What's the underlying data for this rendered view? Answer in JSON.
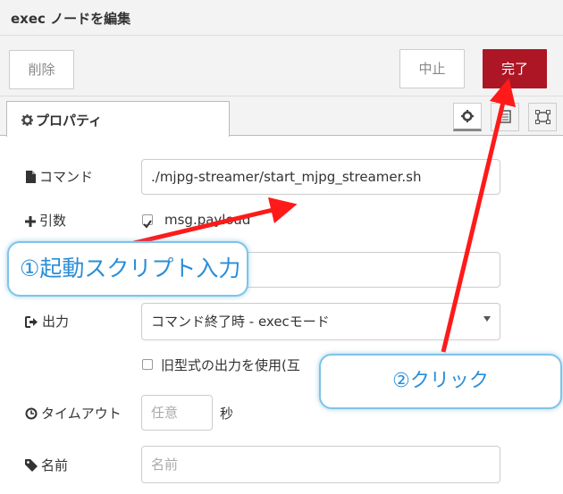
{
  "title": "exec ノードを編集",
  "toolbar": {
    "delete_label": "削除",
    "cancel_label": "中止",
    "done_label": "完了"
  },
  "tabs": {
    "properties_label": "プロパティ"
  },
  "fields": {
    "command": {
      "label": "コマンド",
      "value": "./mjpg-streamer/start_mjpg_streamer.sh"
    },
    "args": {
      "label": "引数",
      "checkbox_label": "msg.payload",
      "checked": true
    },
    "output": {
      "label": "出力",
      "selected": "コマンド終了時 - execモード"
    },
    "legacy": {
      "checkbox_label": "旧型式の出力を使用(互"
    },
    "timeout": {
      "label": "タイムアウト",
      "placeholder": "任意",
      "unit": "秒"
    },
    "name": {
      "label": "名前",
      "placeholder": "名前"
    }
  },
  "annotations": {
    "step1": "①起動スクリプト入力",
    "step2": "②クリック",
    "arrow_color": "#ff1a1a",
    "callout_border": "#7ec4e8",
    "callout_text": "#2a8ed8"
  },
  "colors": {
    "done_button": "#ad1625",
    "panel_bg": "#f3f3f3"
  }
}
